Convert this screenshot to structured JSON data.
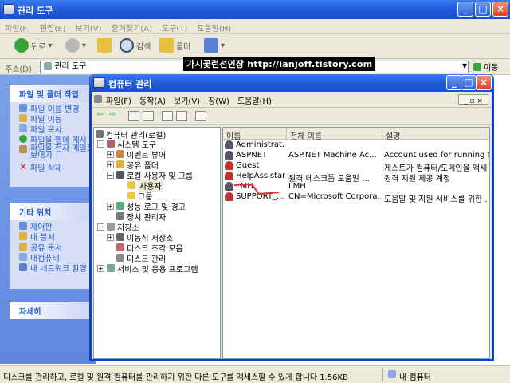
{
  "outer": {
    "title": "관리 도구",
    "menu": [
      "파일(F)",
      "편집(E)",
      "보기(V)",
      "즐겨찾기(A)",
      "도구(T)",
      "도움말(H)"
    ],
    "toolbar": {
      "back": "뒤로",
      "search": "검색",
      "folders": "폴더"
    },
    "address_label": "주소(D)",
    "address_value": "관리 도구",
    "go_label": "이동"
  },
  "leftpane": {
    "file_tasks": {
      "title": "파일 및 폴더 작업",
      "items": [
        "파일 이름 변경",
        "파일 이동",
        "파일 복사",
        "파일을 웹에 게시",
        "파일을 전자 메일로 보내기",
        "파일 삭제"
      ]
    },
    "other_places": {
      "title": "기타 위치",
      "items": [
        "제어판",
        "내 문서",
        "공유 문서",
        "내컴퓨터",
        "내 네트워크 환경"
      ]
    },
    "details": {
      "title": "자세히"
    }
  },
  "inner": {
    "title": "컴퓨터 관리",
    "menu": [
      "파일(F)",
      "동작(A)",
      "보기(V)",
      "창(W)",
      "도움말(H)"
    ],
    "tree": [
      {
        "label": "컴퓨터 관리(로컬)",
        "level": 0,
        "toggle": "−"
      },
      {
        "label": "시스템 도구",
        "level": 1,
        "toggle": "−"
      },
      {
        "label": "이벤트 뷰어",
        "level": 2,
        "toggle": "+"
      },
      {
        "label": "공유 폴더",
        "level": 2,
        "toggle": "+"
      },
      {
        "label": "로컬 사용자 및 그룹",
        "level": 2,
        "toggle": "−"
      },
      {
        "label": "사용자",
        "level": 3,
        "toggle": ""
      },
      {
        "label": "그룹",
        "level": 3,
        "toggle": ""
      },
      {
        "label": "성능 로그 및 경고",
        "level": 2,
        "toggle": "+"
      },
      {
        "label": "장치 관리자",
        "level": 2,
        "toggle": ""
      },
      {
        "label": "저장소",
        "level": 1,
        "toggle": "−"
      },
      {
        "label": "이동식 저장소",
        "level": 2,
        "toggle": "+"
      },
      {
        "label": "디스크 조각 모음",
        "level": 2,
        "toggle": ""
      },
      {
        "label": "디스크 관리",
        "level": 2,
        "toggle": ""
      },
      {
        "label": "서비스 및 응용 프로그램",
        "level": 1,
        "toggle": "+"
      }
    ],
    "columns": [
      "이름",
      "전체 이름",
      "설명"
    ],
    "rows": [
      {
        "name": "Administrat...",
        "full": "",
        "desc": ""
      },
      {
        "name": "ASPNET",
        "full": "ASP.NET Machine Ac...",
        "desc": "Account used for running the"
      },
      {
        "name": "Guest",
        "full": "",
        "desc": "게스트가 컴퓨터/도메인을 액세"
      },
      {
        "name": "HelpAssistant",
        "full": "원격 데스크톱 도움말 ...",
        "desc": "원격 지원 제공 계정"
      },
      {
        "name": "LMH",
        "full": "LMH",
        "desc": ""
      },
      {
        "name": "SUPPORT_...",
        "full": "CN=Microsoft Corpora...",
        "desc": "도움말 및 지원 서비스를 위한 ."
      }
    ]
  },
  "watermark": "가시꽃런선인장 http://ianjoff.tistory.com",
  "status": {
    "text": "디스크를 관리하고, 로컬 및 원격 컴퓨터를 관리하기 위한 다른 도구를 액세스할 수 있게 합니다 1.56KB",
    "location": "내 컴퓨터"
  }
}
